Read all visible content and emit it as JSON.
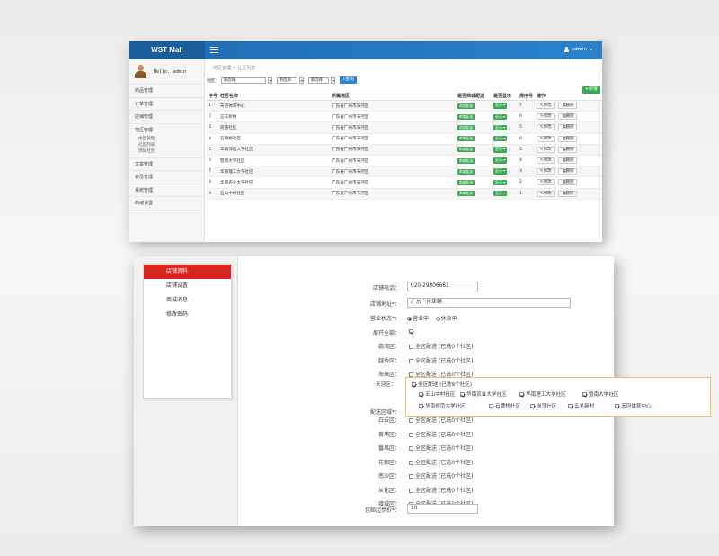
{
  "admin": {
    "brand": "WST Mall",
    "user_label": "admin",
    "hello": "Hello, admin",
    "nav": [
      {
        "label": "商品管理"
      },
      {
        "label": "订单管理"
      },
      {
        "label": "店铺管理"
      },
      {
        "label": "地区管理",
        "children": [
          "地区管理",
          "社区列表",
          "添加社区"
        ]
      },
      {
        "label": "文章管理"
      },
      {
        "label": "会员管理"
      },
      {
        "label": "系统管理"
      },
      {
        "label": "商城设置"
      }
    ],
    "breadcrumb": "地区管理 > 社区列表",
    "filter": {
      "area_label": "地区：",
      "select1": "请选择",
      "select2": "请选择",
      "select3": "请选择",
      "query_button": "查询",
      "add_button": "新增"
    },
    "table": {
      "headers": [
        "序号",
        "社区名称",
        "所属地区",
        "是否商城配送",
        "是否显示",
        "排序号",
        "操作"
      ],
      "ship_badge": "商城配送",
      "show_badge": "显示",
      "edit_label": "修改",
      "delete_label": "删除",
      "rows": [
        {
          "no": "1",
          "name": "天河体育中心",
          "area": "广东省广州市天河区",
          "sort": "7"
        },
        {
          "no": "2",
          "name": "五羊新村",
          "area": "广东省广州市天河区",
          "sort": "6"
        },
        {
          "no": "3",
          "name": "岗顶社区",
          "area": "广东省广州市天河区",
          "sort": "5"
        },
        {
          "no": "4",
          "name": "石牌桥社区",
          "area": "广东省广州市天河区",
          "sort": "6"
        },
        {
          "no": "5",
          "name": "华南师范大学社区",
          "area": "广东省广州市天河区",
          "sort": "5"
        },
        {
          "no": "6",
          "name": "暨南大学社区",
          "area": "广东省广州市天河区",
          "sort": "4"
        },
        {
          "no": "7",
          "name": "华南理工大学社区",
          "area": "广东省广州市天河区",
          "sort": "3"
        },
        {
          "no": "8",
          "name": "华南农业大学社区",
          "area": "广东省广州市天河区",
          "sort": "2"
        },
        {
          "no": "9",
          "name": "五山中村社区",
          "area": "广东省广州市天河区",
          "sort": "1"
        }
      ]
    }
  },
  "shop": {
    "menu": [
      {
        "label": "店铺资料",
        "active": true
      },
      {
        "label": "店铺设置",
        "active": false
      },
      {
        "label": "商城消息",
        "active": false
      },
      {
        "label": "修改密码",
        "active": false
      }
    ],
    "phone_label": "店铺电话：",
    "phone_value": "020-29806661",
    "address_label": "店铺地址*：",
    "address_value": "广东广州店铺",
    "status_label": "营业状态*：",
    "status_open": "营业中",
    "status_closed": "休息中",
    "expand_all": "展开全部：",
    "delivery_label": "配送区域*：",
    "district_option": "全区配送 (已选0个社区)",
    "districts": [
      "荔湾区：",
      "越秀区：",
      "海珠区："
    ],
    "tianhe": {
      "label": "天河区：",
      "option": "全区配送 (已选9个社区)",
      "communities": [
        "五山中村社区",
        "华南农业大学社区",
        "华南理工大学社区",
        "暨南大学社区",
        "华南师范大学社区",
        "石牌桥社区",
        "岗顶社区",
        "五羊新村",
        "天河体育中心"
      ]
    },
    "districts_after": [
      "白云区：",
      "黄埔区：",
      "番禺区：",
      "花都区：",
      "南沙区：",
      "从化区：",
      "增城区："
    ],
    "min_price_label": "包邮起步价*：",
    "min_price_value": "10"
  }
}
